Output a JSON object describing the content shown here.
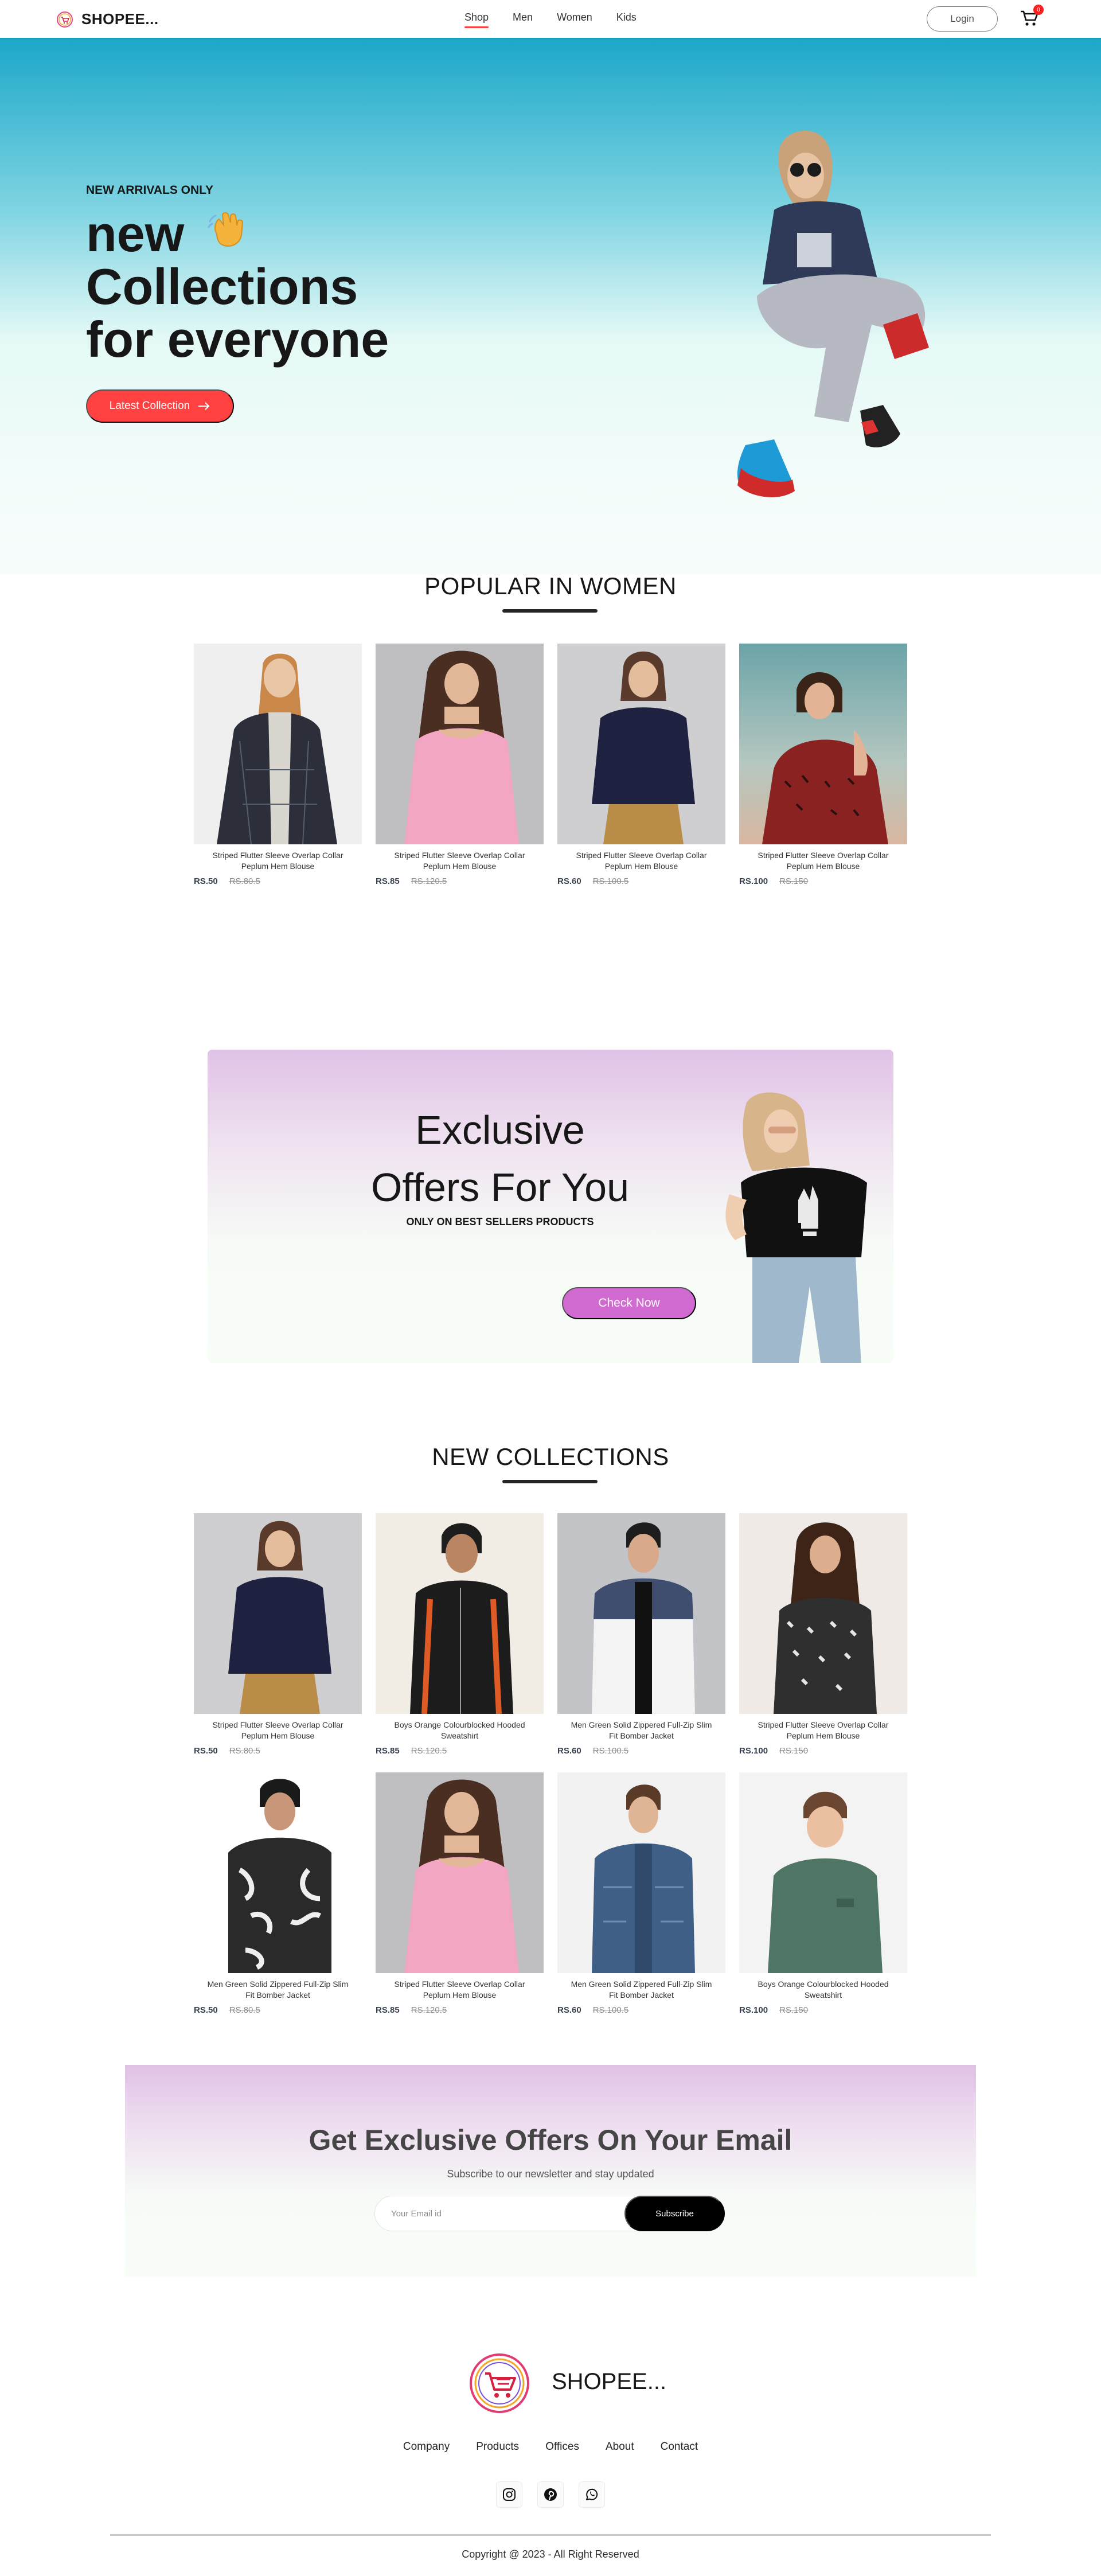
{
  "colors": {
    "accent": "#ff4141",
    "offer_button": "#d16ad0",
    "hero_top": "#1ca7c9",
    "hero_bottom": "#f8fdfc",
    "offer_gradient_top": "#e0c2e6",
    "text_dark": "#171717"
  },
  "navbar": {
    "brand": "SHOPEE...",
    "logo_icon": "cart-logo-icon",
    "menu": [
      {
        "label": "Shop",
        "active": true
      },
      {
        "label": "Men",
        "active": false
      },
      {
        "label": "Women",
        "active": false
      },
      {
        "label": "Kids",
        "active": false
      }
    ],
    "login_label": "Login",
    "cart_icon": "cart-icon",
    "cart_count": "0"
  },
  "hero": {
    "eyebrow": "NEW ARRIVALS ONLY",
    "title_line1": "new",
    "wave_icon": "waving-hand-icon",
    "title_line2": "Collections",
    "title_line3": "for everyone",
    "button_label": "Latest Collection",
    "button_icon": "arrow-right-icon"
  },
  "popular": {
    "title": "POPULAR IN WOMEN",
    "items": [
      {
        "name": "Striped Flutter Sleeve Overlap Collar Peplum Hem Blouse",
        "new_price": "RS.50",
        "old_price": "RS.80.5"
      },
      {
        "name": "Striped Flutter Sleeve Overlap Collar Peplum Hem Blouse",
        "new_price": "RS.85",
        "old_price": "RS.120.5"
      },
      {
        "name": "Striped Flutter Sleeve Overlap Collar Peplum Hem Blouse",
        "new_price": "RS.60",
        "old_price": "RS.100.5"
      },
      {
        "name": "Striped Flutter Sleeve Overlap Collar Peplum Hem Blouse",
        "new_price": "RS.100",
        "old_price": "RS.150"
      }
    ]
  },
  "offers": {
    "title_line1": "Exclusive",
    "title_line2": "Offers For You",
    "subtitle": "ONLY ON BEST SELLERS PRODUCTS",
    "button_label": "Check Now"
  },
  "new_collections": {
    "title": "NEW COLLECTIONS",
    "items": [
      {
        "name": "Striped Flutter Sleeve Overlap Collar Peplum Hem Blouse",
        "new_price": "RS.50",
        "old_price": "RS.80.5"
      },
      {
        "name": "Boys Orange Colourblocked Hooded Sweatshirt",
        "new_price": "RS.85",
        "old_price": "RS.120.5"
      },
      {
        "name": "Men Green Solid Zippered Full-Zip Slim Fit Bomber Jacket",
        "new_price": "RS.60",
        "old_price": "RS.100.5"
      },
      {
        "name": "Striped Flutter Sleeve Overlap Collar Peplum Hem Blouse",
        "new_price": "RS.100",
        "old_price": "RS.150"
      },
      {
        "name": "Men Green Solid Zippered Full-Zip Slim Fit Bomber Jacket",
        "new_price": "RS.50",
        "old_price": "RS.80.5"
      },
      {
        "name": "Striped Flutter Sleeve Overlap Collar Peplum Hem Blouse",
        "new_price": "RS.85",
        "old_price": "RS.120.5"
      },
      {
        "name": "Men Green Solid Zippered Full-Zip Slim Fit Bomber Jacket",
        "new_price": "RS.60",
        "old_price": "RS.100.5"
      },
      {
        "name": "Boys Orange Colourblocked Hooded Sweatshirt",
        "new_price": "RS.100",
        "old_price": "RS.150"
      }
    ]
  },
  "newsletter": {
    "title": "Get Exclusive Offers On Your Email",
    "subtitle": "Subscribe to our newsletter and stay updated",
    "placeholder": "Your Email id",
    "button_label": "Subscribe"
  },
  "footer": {
    "brand": "SHOPEE...",
    "logo_icon": "cart-logo-icon",
    "links": [
      "Company",
      "Products",
      "Offices",
      "About",
      "Contact"
    ],
    "social_icons": [
      "instagram-icon",
      "pinterest-icon",
      "whatsapp-icon"
    ],
    "copyright": "Copyright @ 2023 - All Right Reserved"
  }
}
